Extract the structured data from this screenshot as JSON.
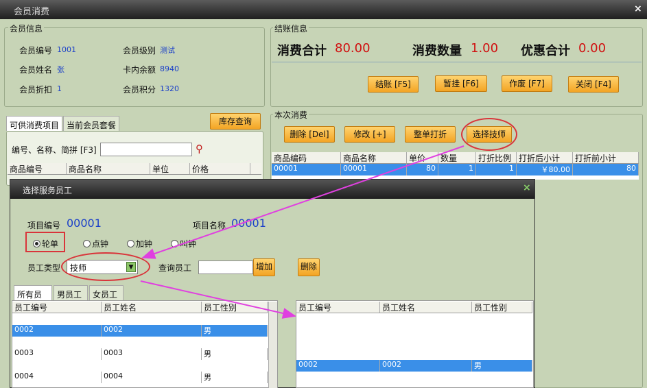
{
  "window": {
    "title": "会员消费",
    "close": "×"
  },
  "member": {
    "legend": "会员信息",
    "fields": [
      {
        "label": "会员编号",
        "value": "1001"
      },
      {
        "label": "会员级别",
        "value": "测试"
      },
      {
        "label": "会员姓名",
        "value": "张"
      },
      {
        "label": "卡内余额",
        "value": "8940"
      },
      {
        "label": "会员折扣",
        "value": "1"
      },
      {
        "label": "会员积分",
        "value": "1320"
      }
    ]
  },
  "checkout": {
    "legend": "结账信息",
    "total_label": "消费合计",
    "total": "80.00",
    "qty_label": "消费数量",
    "qty": "1.00",
    "discount_label": "优惠合计",
    "discount": "0.00",
    "buttons": [
      "结账 [F5]",
      "暂挂 [F6]",
      "作废 [F7]",
      "关闭 [F4]"
    ]
  },
  "left": {
    "tabs": [
      "可供消费项目",
      "当前会员套餐"
    ],
    "stock_btn": "库存查询",
    "search_label": "编号、名称、简拼 [F3]",
    "search_value": "",
    "headers": [
      "商品编号",
      "商品名称",
      "单位",
      "价格"
    ]
  },
  "current": {
    "legend": "本次消费",
    "buttons": [
      "删除 [Del]",
      "修改 [+]",
      "整单打折",
      "选择技师"
    ],
    "headers": [
      "商品编码",
      "商品名称",
      "单价",
      "数量",
      "打折比例",
      "打折后小计",
      "打折前小计"
    ],
    "rows": [
      [
        "00001",
        "00001",
        "80",
        "1",
        "1",
        "￥80.00",
        "80"
      ]
    ]
  },
  "dialog": {
    "title": "选择服务员工",
    "close": "×",
    "item_no_label": "项目编号",
    "item_no": "00001",
    "item_name_label": "项目名称",
    "item_name": "00001",
    "radios": [
      "轮单",
      "点钟",
      "加钟",
      "叫钟"
    ],
    "type_label": "员工类型",
    "type_value": "技师",
    "query_label": "查询员工",
    "query_value": "",
    "add_btn": "增加",
    "del_btn": "删除",
    "tabs": [
      "所有员工",
      "男员工",
      "女员工"
    ],
    "headers": [
      "员工编号",
      "员工姓名",
      "员工性别"
    ],
    "rows": [
      [
        "0002",
        "0002",
        "男"
      ],
      [
        "0003",
        "0003",
        "男"
      ],
      [
        "0004",
        "0004",
        "男"
      ]
    ],
    "selected_headers": [
      "员工编号",
      "员工姓名",
      "员工性别"
    ],
    "selected_rows": [
      [
        "0002",
        "0002",
        "男"
      ]
    ]
  },
  "colors": {
    "accent_red": "#d9343a",
    "arrow": "#e040e0",
    "selection": "#3a8fe8"
  }
}
